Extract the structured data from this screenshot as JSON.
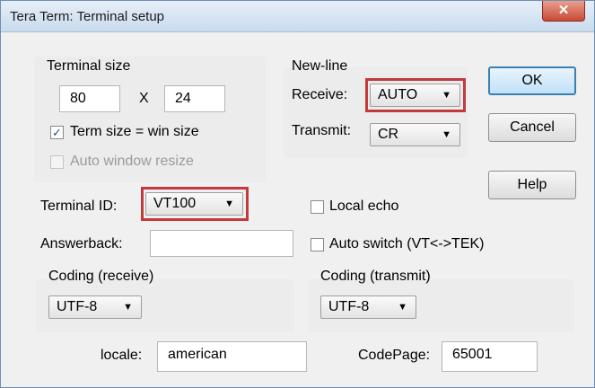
{
  "window": {
    "title": "Tera Term: Terminal setup",
    "close_glyph": "✕"
  },
  "terminal_size": {
    "heading": "Terminal size",
    "width": "80",
    "separator": "X",
    "height": "24",
    "term_size_label": "Term size = win size",
    "term_size_checked": true,
    "auto_resize_label": "Auto window resize",
    "auto_resize_checked": false
  },
  "newline": {
    "heading": "New-line",
    "receive_label": "Receive:",
    "receive_value": "AUTO",
    "transmit_label": "Transmit:",
    "transmit_value": "CR"
  },
  "buttons": {
    "ok": "OK",
    "cancel": "Cancel",
    "help": "Help"
  },
  "terminal_id": {
    "label": "Terminal ID:",
    "value": "VT100"
  },
  "local_echo": {
    "label": "Local echo",
    "checked": false
  },
  "answerback": {
    "label": "Answerback:",
    "value": ""
  },
  "auto_switch": {
    "label": "Auto switch (VT<->TEK)",
    "checked": false
  },
  "coding_receive": {
    "label": "Coding (receive)",
    "value": "UTF-8"
  },
  "coding_transmit": {
    "label": "Coding (transmit)",
    "value": "UTF-8"
  },
  "locale": {
    "label": "locale:",
    "value": "american"
  },
  "codepage": {
    "label": "CodePage:",
    "value": "65001"
  },
  "dropdown_arrow": "▼",
  "check_glyph": "✓",
  "colors": {
    "highlight": "#c33a3a",
    "title_bar": "#c9dbee",
    "close_button": "#c74a35"
  }
}
